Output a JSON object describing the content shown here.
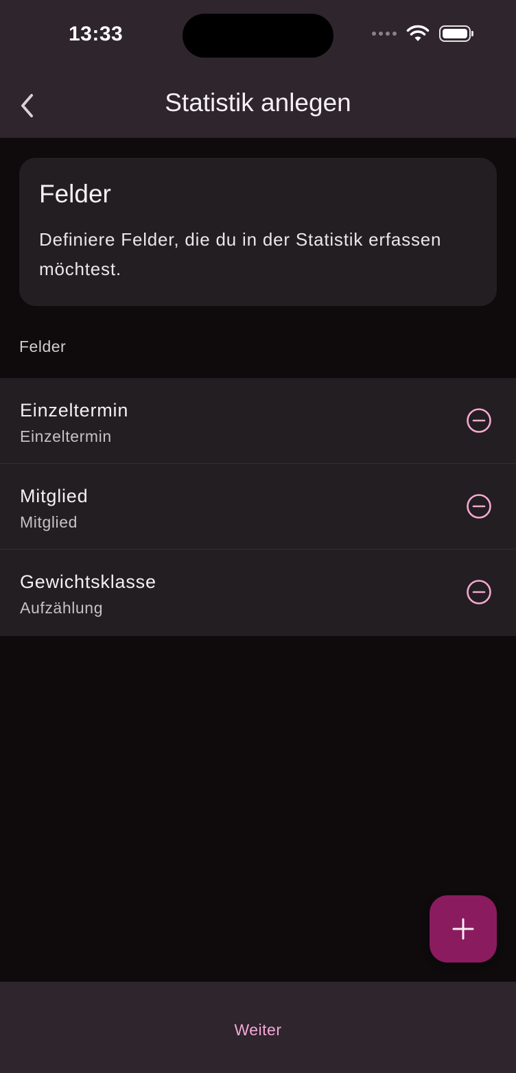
{
  "status_bar": {
    "time": "13:33"
  },
  "app_bar": {
    "title": "Statistik anlegen",
    "back_icon": "chevron-left-icon"
  },
  "info_card": {
    "title": "Felder",
    "description": "Definiere Felder, die du in der Statistik erfassen möchtest."
  },
  "section": {
    "label": "Felder"
  },
  "fields": [
    {
      "name": "Einzeltermin",
      "type": "Einzeltermin",
      "action_icon": "minus-circle-icon"
    },
    {
      "name": "Mitglied",
      "type": "Mitglied",
      "action_icon": "minus-circle-icon"
    },
    {
      "name": "Gewichtsklasse",
      "type": "Aufzählung",
      "action_icon": "minus-circle-icon"
    }
  ],
  "fab": {
    "icon": "plus-icon"
  },
  "bottom_bar": {
    "next_label": "Weiter"
  },
  "colors": {
    "background": "#0f0b0d",
    "bar": "#2f252d",
    "surface": "#231e21",
    "accent": "#f6a8d6",
    "fab": "#8a1b5f"
  }
}
